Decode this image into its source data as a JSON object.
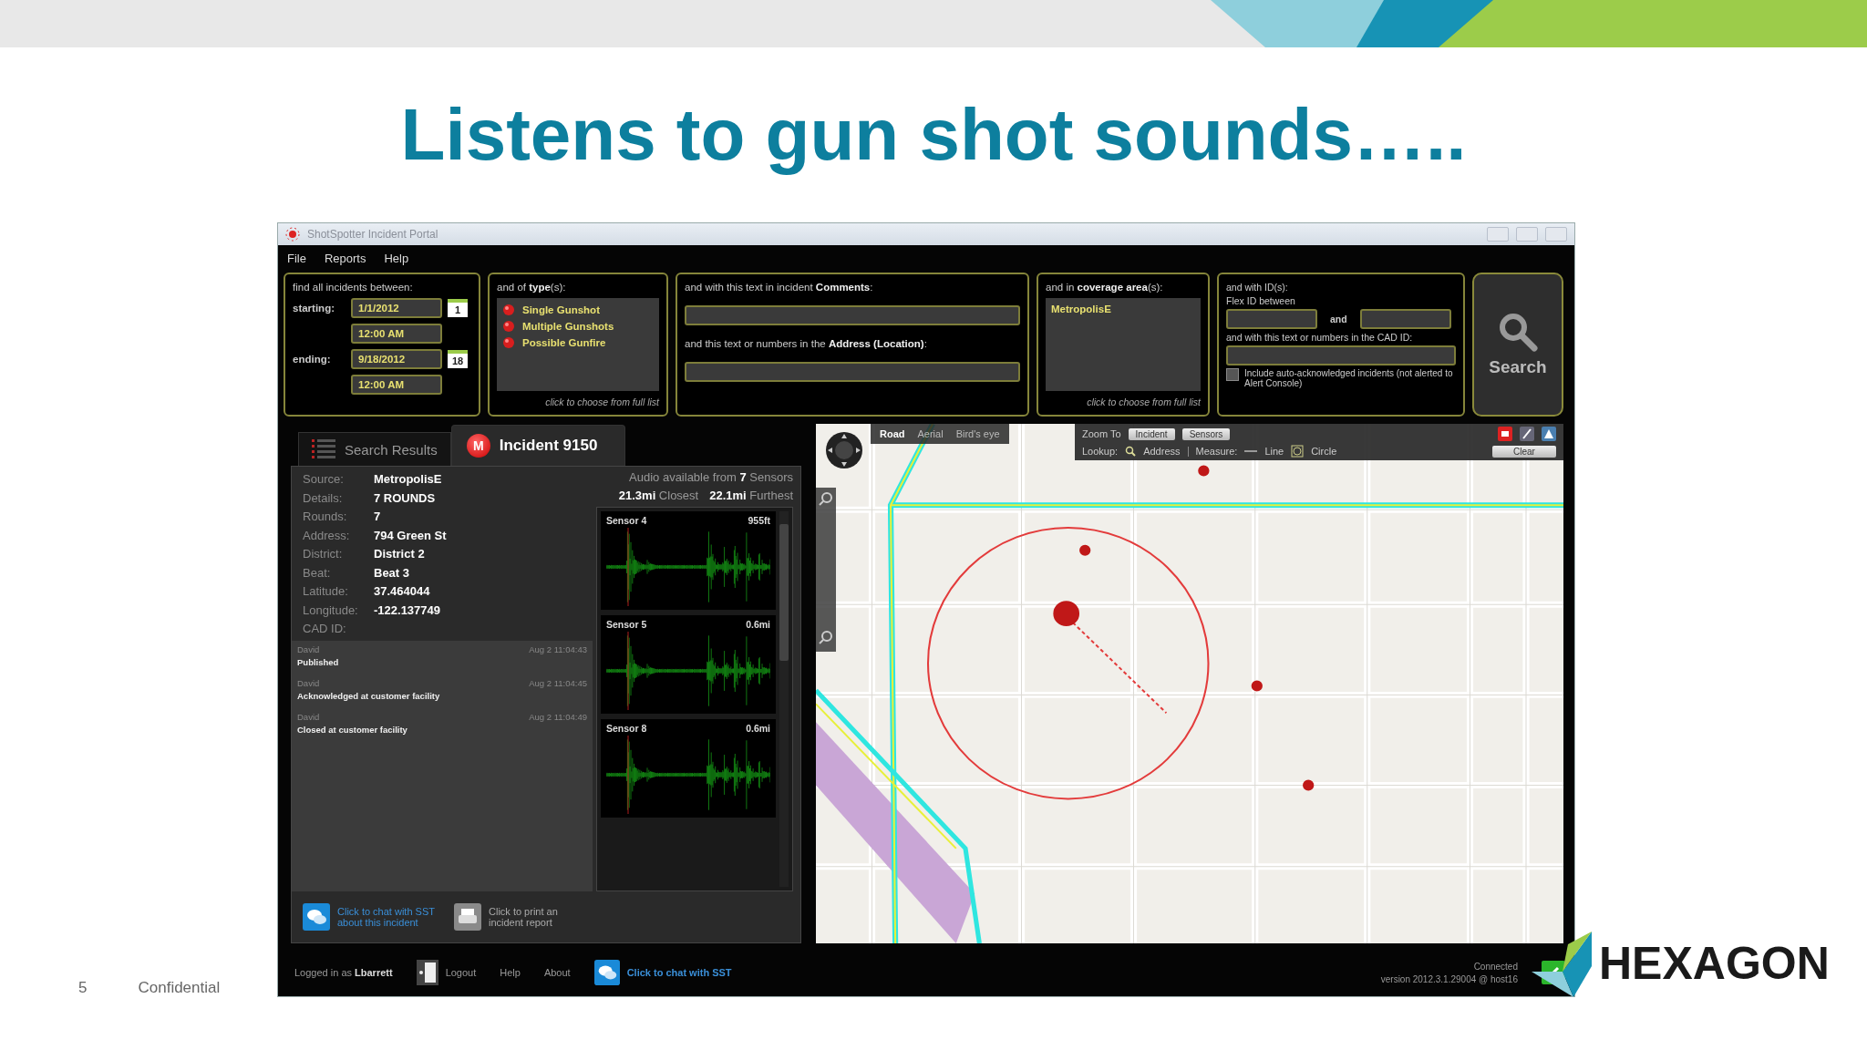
{
  "slide": {
    "title": "Listens to gun shot sounds…..",
    "page_number": "5",
    "footer": "Confidential",
    "logo": "HEXAGON"
  },
  "window": {
    "title": "ShotSpotter Incident Portal"
  },
  "menu": [
    "File",
    "Reports",
    "Help"
  ],
  "filters": {
    "dates": {
      "heading": "find all incidents between:",
      "starting_label": "starting:",
      "start_date": "1/1/2012",
      "start_day": "1",
      "start_time": "12:00 AM",
      "ending_label": "ending:",
      "end_date": "9/18/2012",
      "end_day": "18",
      "end_time": "12:00 AM"
    },
    "types": {
      "heading": "and of **type**(s):",
      "items": [
        "Single Gunshot",
        "Multiple Gunshots",
        "Possible Gunfire"
      ],
      "hint": "click to choose from full list"
    },
    "text": {
      "comments_label": "and with this text in incident **Comments**:",
      "address_label": "and this text or numbers in the **Address (Location)**:"
    },
    "coverage": {
      "heading": "and in **coverage area**(s):",
      "items": [
        "MetropolisE"
      ],
      "hint": "click to choose from full list"
    },
    "ids": {
      "heading": "and with ID(s):",
      "flex_label": "Flex ID between",
      "and_label": "and",
      "cad_label": "and with this text or numbers in the CAD ID:",
      "checkbox_label": "Include auto-acknowledged incidents (not alerted to Alert Console)",
      "checked": false
    },
    "search_button": "Search"
  },
  "incident": {
    "tabs": [
      {
        "label": "Search Results",
        "selected": false
      },
      {
        "label": "Incident 9150",
        "selected": true
      }
    ],
    "badge": "M",
    "fields": [
      {
        "label": "Source:",
        "value": "MetropolisE"
      },
      {
        "label": "Details:",
        "value": "7 ROUNDS"
      },
      {
        "label": "Rounds:",
        "value": "7"
      },
      {
        "label": "Address:",
        "value": "794 Green  St"
      },
      {
        "label": "District:",
        "value": "District 2"
      },
      {
        "label": "Beat:",
        "value": "Beat 3"
      },
      {
        "label": "Latitude:",
        "value": "37.464044"
      },
      {
        "label": "Longitude:",
        "value": "-122.137749"
      },
      {
        "label": "CAD ID:"
      }
    ],
    "log": [
      {
        "user": "David",
        "time": "Aug 2 11:04:43",
        "text": "Published"
      },
      {
        "user": "David",
        "time": "Aug 2 11:04:45",
        "text": "Acknowledged at customer facility"
      },
      {
        "user": "David",
        "time": "Aug 2 11:04:49",
        "text": "Closed at customer facility"
      }
    ],
    "audio": {
      "summary": "Audio available from **7** Sensors",
      "closest": "**21.3mi** Closest",
      "furthest": "**22.1mi** Furthest"
    },
    "sensors": [
      {
        "name": "Sensor 4",
        "distance": "955ft"
      },
      {
        "name": "Sensor 5",
        "distance": "0.6mi"
      },
      {
        "name": "Sensor 8",
        "distance": "0.6mi"
      }
    ],
    "actions": [
      "Click to chat with SST about this incident",
      "Click to print an incident report"
    ]
  },
  "map": {
    "views": [
      {
        "label": "Road",
        "selected": true
      },
      {
        "label": "Aerial",
        "selected": false
      },
      {
        "label": "Bird's eye",
        "selected": false
      }
    ],
    "zoom_label": "Zoom To",
    "zoom_buttons": [
      "Incident",
      "Sensors"
    ],
    "lookup_label": "Lookup:",
    "lookup": "Address",
    "measure_label": "Measure:",
    "measure": [
      "Line",
      "Circle"
    ],
    "clear": "Clear"
  },
  "status_bar": {
    "user": "Logged in as **Lbarrett**",
    "links": [
      "Logout",
      "Help",
      "About"
    ],
    "chat": "Click to chat with SST",
    "connection": "Connected",
    "version": "version 2012.3.1.29004 @ host16"
  }
}
